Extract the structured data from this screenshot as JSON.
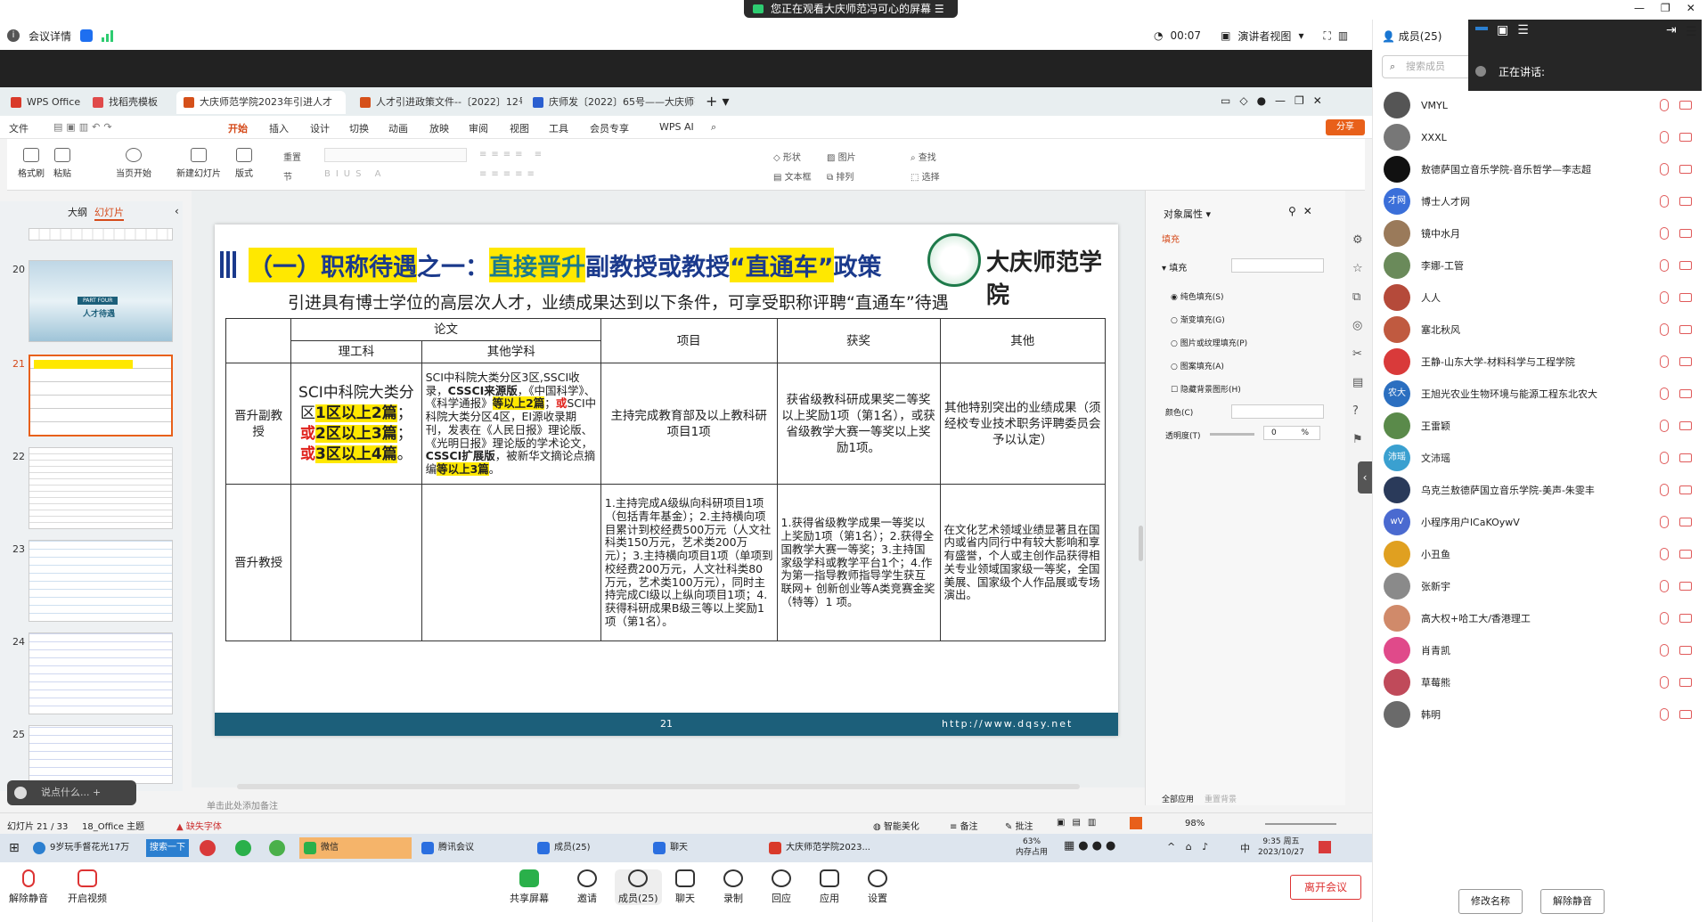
{
  "meeting": {
    "banner": "您正在观看大庆师范冯可心的屏幕",
    "details": "会议详情",
    "timer": "00:07",
    "view_mode": "演讲者视图",
    "members_title": "成员(25)",
    "search_placeholder": "搜索成员",
    "speaking": "正在讲话:"
  },
  "browser_tabs": [
    {
      "label": "WPS Office"
    },
    {
      "label": "找稻壳模板"
    },
    {
      "label": "大庆师范学院2023年引进人才"
    },
    {
      "label": "人才引进政策文件--〔2022〕12号("
    },
    {
      "label": "庆师发〔2022〕65号——大庆师范学"
    }
  ],
  "menu": [
    "文件",
    "开始",
    "插入",
    "设计",
    "切换",
    "动画",
    "放映",
    "审阅",
    "视图",
    "工具",
    "会员专享",
    "WPS AI"
  ],
  "menu_share": "分享",
  "ribbon": {
    "format_painter": "格式刷",
    "paste": "粘贴",
    "play": "当页开始",
    "new_slide": "新建幻灯片",
    "layout": "版式",
    "reset": "重置",
    "section": "节",
    "shape": "形状",
    "picture": "图片",
    "textbox": "文本框",
    "arrange": "排列",
    "find": "查找",
    "select": "选择"
  },
  "outline": {
    "tab_outline": "大纲",
    "tab_slides": "幻灯片",
    "slide_numbers": [
      "20",
      "21",
      "22",
      "23",
      "24",
      "25"
    ],
    "part_four": "PART FOUR",
    "part_title": "人才待遇"
  },
  "slide": {
    "title_parts": [
      "（一）职称待遇",
      "之一：",
      "直接晋升",
      "副教授或教授",
      "“直通车”",
      "政策"
    ],
    "university": "大庆师范学院",
    "subtitle": "引进具有博士学位的高层次人才，业绩成果达到以下条件，可享受职称评聘“直通车”待遇",
    "headers": {
      "paper": "论文",
      "sci_eng": "理工科",
      "other_subj": "其他学科",
      "project": "项目",
      "award": "获奖",
      "other": "其他"
    },
    "row1": {
      "label": "晋升副教授",
      "sci_parts": [
        "SCI中科院大类分区",
        "1区以上2篇",
        "；",
        "或",
        "2区以上3篇",
        "；",
        "或",
        "3区以上4篇",
        "。"
      ],
      "other_parts": [
        "SCI中科院大类分区3区,SSCI收录，",
        "CSSCI来源版",
        "，《中国科学》、《科学通报》",
        "等以上2篇",
        "；",
        "或",
        "SCI中科院大类分区4区，EI源收录期刊，发表在《人民日报》理论版、《光明日报》理论版的学术论文，",
        "CSSCI扩展版",
        "，被新华文摘论点摘编",
        "等以上3篇",
        "。"
      ],
      "project": "主持完成教育部及以上教科研项目1项",
      "award": "获省级教科研成果奖二等奖以上奖励1项（第1名），或获省级教学大赛一等奖以上奖励1项。",
      "other": "其他特别突出的业绩成果（须经校专业技术职务评聘委员会予以认定）"
    },
    "row2": {
      "label": "晋升教授",
      "project": "1.主持完成A级纵向科研项目1项（包括青年基金）；2.主持横向项目累计到校经费500万元（人文社科类150万元，艺术类200万元）；3.主持横向项目1项（单项到校经费200万元，人文社科类80万元，艺术类100万元），同时主持完成CⅠ级以上纵向项目1项；4.获得科研成果B级三等以上奖励1项（第1名）。",
      "award": "1.获得省级教学成果一等奖以上奖励1项（第1名）；2.获得全国教学大赛一等奖；3.主持国家级学科或教学平台1个；4.作为第一指导教师指导学生获互联网+ 创新创业等A类竞赛金奖（特等）1 项。",
      "other": "在文化艺术领域业绩显著且在国内或省内同行中有较大影响和享有盛誉，个人或主创作品获得相关专业领域国家级一等奖，全国美展、国家级个人作品展或专场演出。"
    },
    "page": "21",
    "url": "http://www.dqsy.net"
  },
  "notes_placeholder": "单击此处添加备注",
  "ask_placeholder": "说点什么...",
  "props": {
    "title": "对象属性",
    "tab": "填充",
    "fill": "填充",
    "solid": "纯色填充(S)",
    "gradient": "渐变填充(G)",
    "picture": "图片或纹理填充(P)",
    "pattern": "图案填充(A)",
    "hide_bg": "隐藏背景图形(H)",
    "color": "颜色(C)",
    "transparency": "透明度(T)",
    "transparency_value": "0",
    "percent": "%",
    "apply_all": "全部应用",
    "reset_bg": "重置背景"
  },
  "status": {
    "slide": "幻灯片 21 / 33",
    "theme": "18_Office 主题",
    "missing_font": "缺失字体",
    "smart": "智能美化",
    "notes": "备注",
    "comment": "批注",
    "zoom": "98%"
  },
  "taskbar": {
    "search": "9岁玩手督花光17万",
    "search_btn": "搜索一下",
    "wechat": "微信",
    "tencent_meeting": "腾讯会议",
    "members": "成员(25)",
    "chat": "聊天",
    "wps": "大庆师范学院2023...",
    "mem_pct": "63%",
    "mem_label": "内存占用",
    "ime": "中",
    "time": "9:35 周五",
    "date": "2023/10/27"
  },
  "bottom": {
    "unmute": "解除静音",
    "video": "开启视频",
    "share": "共享屏幕",
    "invite": "邀请",
    "members": "成员(25)",
    "chat": "聊天",
    "record": "录制",
    "replay": "回应",
    "apps": "应用",
    "settings": "设置",
    "leave": "离开会议"
  },
  "member_list": [
    {
      "name": "VMYL",
      "color": "#555555",
      "txt": ""
    },
    {
      "name": "XXXL",
      "color": "#777777",
      "txt": ""
    },
    {
      "name": "敖德萨国立音乐学院-音乐哲学—李志超",
      "color": "#111111",
      "txt": ""
    },
    {
      "name": "博士人才网",
      "color": "#3b6fd9",
      "txt": "才网"
    },
    {
      "name": "镜中水月",
      "color": "#9a7a5a",
      "txt": ""
    },
    {
      "name": "李娜-工管",
      "color": "#6a8a5a",
      "txt": ""
    },
    {
      "name": "人人",
      "color": "#b54a3a",
      "txt": ""
    },
    {
      "name": "塞北秋风",
      "color": "#c05a40",
      "txt": ""
    },
    {
      "name": "王静-山东大学-材料科学与工程学院",
      "color": "#d93a3a",
      "txt": ""
    },
    {
      "name": "王旭光农业生物环境与能源工程东北农大",
      "color": "#2b6fc0",
      "txt": "农大"
    },
    {
      "name": "王雷颖",
      "color": "#5a8a4a",
      "txt": ""
    },
    {
      "name": "文沛瑶",
      "color": "#3aa0d0",
      "txt": "沛瑶"
    },
    {
      "name": "乌克兰敖德萨国立音乐学院-美声-朱雯丰",
      "color": "#2a3a5a",
      "txt": ""
    },
    {
      "name": "小程序用户lCaKOywV",
      "color": "#4a6ad0",
      "txt": "wV"
    },
    {
      "name": "小丑鱼",
      "color": "#e0a020",
      "txt": ""
    },
    {
      "name": "张新宇",
      "color": "#8a8a8a",
      "txt": ""
    },
    {
      "name": "高大权+哈工大/香港理工",
      "color": "#d08a6a",
      "txt": ""
    },
    {
      "name": "肖青凯",
      "color": "#e04a8a",
      "txt": ""
    },
    {
      "name": "草莓熊",
      "color": "#c04a5a",
      "txt": ""
    },
    {
      "name": "韩明",
      "color": "#6a6a6a",
      "txt": ""
    }
  ],
  "member_buttons": {
    "rename": "修改名称",
    "unmute": "解除静音"
  }
}
